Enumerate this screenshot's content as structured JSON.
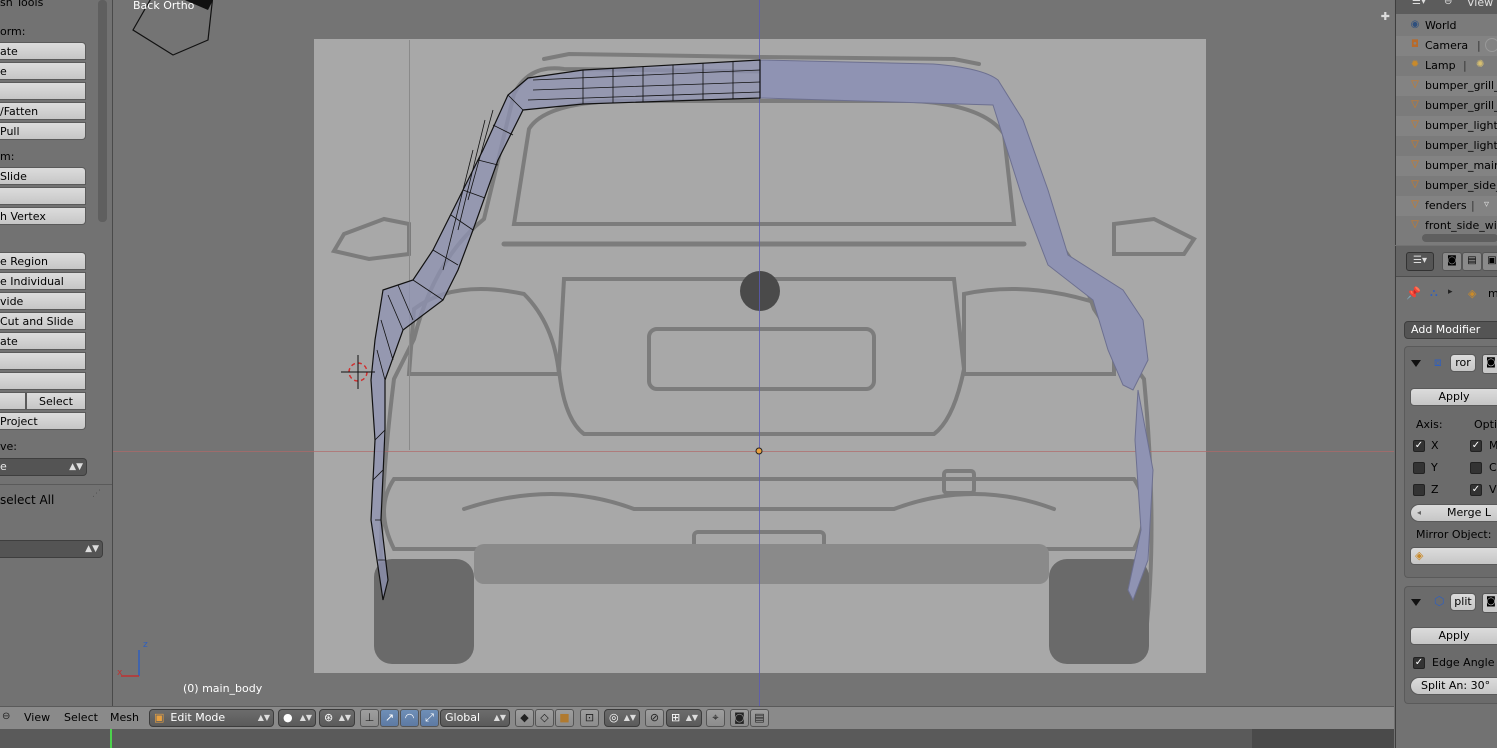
{
  "toolshelf": {
    "title": "sh Tools",
    "transform_label": "orm:",
    "transform_buttons": [
      "ate",
      "e",
      "",
      "/Fatten",
      "Pull"
    ],
    "deform_label": "m:",
    "deform_buttons": [
      "Slide",
      "",
      "h Vertex"
    ],
    "add_buttons": [
      "e Region",
      "e Individual",
      "vide",
      "Cut and Slide",
      "ate",
      "",
      ""
    ],
    "select_button": "Select",
    "project_button": "Project",
    "remove_label": "ve:",
    "remove_select": "e",
    "deselect_all": "select All"
  },
  "viewport": {
    "view_name": "Back Ortho",
    "object_name": "(0) main_body",
    "axis_z": "z",
    "axis_x": "x"
  },
  "header": {
    "menu_view": "View",
    "menu_select": "Select",
    "menu_mesh": "Mesh",
    "mode": "Edit Mode",
    "orientation": "Global"
  },
  "outliner": {
    "header_label": "View",
    "items": [
      {
        "label": "World",
        "icon": "world-icon"
      },
      {
        "label": "Camera",
        "icon": "camera-icon"
      },
      {
        "label": "Lamp",
        "icon": "lamp-icon"
      },
      {
        "label": "bumper_grill_c",
        "icon": "mesh-icon"
      },
      {
        "label": "bumper_grill_s",
        "icon": "mesh-icon"
      },
      {
        "label": "bumper_light",
        "icon": "mesh-icon"
      },
      {
        "label": "bumper_light_r",
        "icon": "mesh-icon"
      },
      {
        "label": "bumper_main",
        "icon": "mesh-icon"
      },
      {
        "label": "bumper_side_k",
        "icon": "mesh-icon"
      },
      {
        "label": "fenders",
        "icon": "mesh-icon"
      },
      {
        "label": "front_side_wind",
        "icon": "mesh-icon"
      }
    ]
  },
  "properties": {
    "object_short": "m",
    "add_modifier": "Add Modifier",
    "mirror": {
      "name": "ror",
      "apply": "Apply",
      "axis_label": "Axis:",
      "options_label": "Optio",
      "axes": [
        {
          "label": "X",
          "checked": true
        },
        {
          "label": "Y",
          "checked": false
        },
        {
          "label": "Z",
          "checked": false
        }
      ],
      "options": [
        {
          "label": "M",
          "checked": true
        },
        {
          "label": "C",
          "checked": false
        },
        {
          "label": "V",
          "checked": true
        }
      ],
      "merge": "Merge L",
      "mirror_object_label": "Mirror Object:"
    },
    "edge_split": {
      "name": "plit",
      "apply": "Apply",
      "edge_angle": "Edge Angle",
      "edge_angle_checked": true,
      "split_angle": "Split An: 30°"
    }
  },
  "colors": {
    "background": "#727272",
    "selected_button": "#5d7aa3",
    "mesh_face": "#8a8fb0",
    "x_axis_line": "#b56a6a",
    "y_axis_line": "#5a5ab8",
    "timeline_cursor": "#4cd24c"
  }
}
